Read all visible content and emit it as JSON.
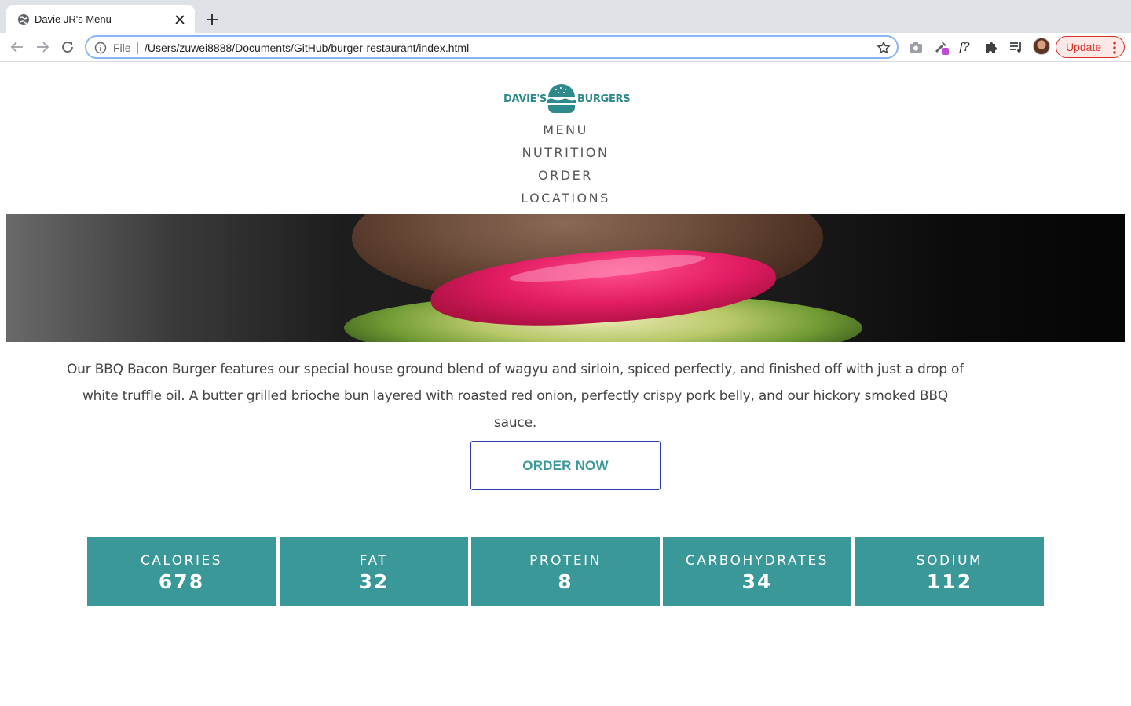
{
  "browser": {
    "tab_title": "Davie JR's Menu",
    "scheme_label": "File",
    "url": "/Users/zuwei8888/Documents/GitHub/burger-restaurant/index.html",
    "update_label": "Update",
    "extensions": [
      "camera-icon",
      "eyedropper-icon",
      "fonts-icon",
      "puzzle-icon",
      "reading-list-icon"
    ]
  },
  "site": {
    "logo_left": "DAVIE'S",
    "logo_right": "BURGERS",
    "brand_color": "#3a9899"
  },
  "nav": {
    "items": [
      "MENU",
      "NUTRITION",
      "ORDER",
      "LOCATIONS"
    ]
  },
  "main": {
    "description": "Our BBQ Bacon Burger features our special house ground blend of wagyu and sirloin, spiced perfectly, and finished off with just a drop of white truffle oil. A butter grilled brioche bun layered with roasted red onion, perfectly crispy pork belly, and our hickory smoked BBQ sauce.",
    "order_button": "ORDER NOW"
  },
  "nutrition": [
    {
      "label": "CALORIES",
      "value": "678"
    },
    {
      "label": "FAT",
      "value": "32"
    },
    {
      "label": "PROTEIN",
      "value": "8"
    },
    {
      "label": "CARBOHYDRATES",
      "value": "34"
    },
    {
      "label": "SODIUM",
      "value": "112"
    }
  ]
}
